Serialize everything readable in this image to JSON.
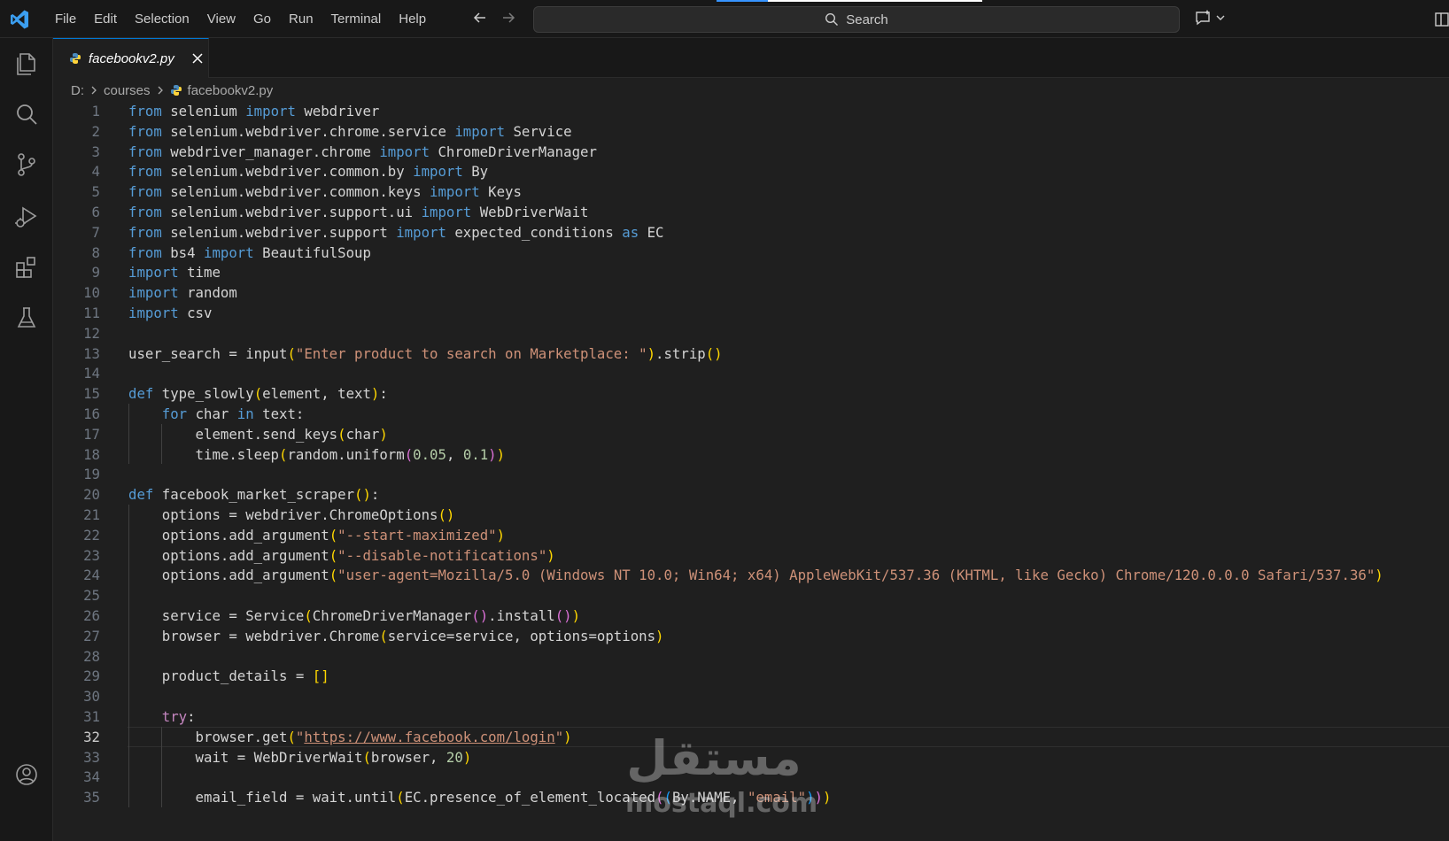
{
  "menu": [
    "File",
    "Edit",
    "Selection",
    "View",
    "Go",
    "Run",
    "Terminal",
    "Help"
  ],
  "search": {
    "label": "Search"
  },
  "tab": {
    "name": "facebookv2.py"
  },
  "breadcrumb": {
    "drive": "D:",
    "folder": "courses",
    "file": "facebookv2.py"
  },
  "editor": {
    "current_line": 32
  },
  "watermark": {
    "text": "mostaql.com",
    "logo_text": "مستقل"
  },
  "colors": {
    "accent": "#0078d4",
    "keyword": "#569cd6",
    "control": "#c586c0",
    "function": "#dcdcaa",
    "string": "#ce9178",
    "number": "#b5cea8"
  },
  "icons": [
    "explorer-icon",
    "search-icon",
    "source-control-icon",
    "run-debug-icon",
    "extensions-icon",
    "testing-icon",
    "account-icon",
    "python-file-icon",
    "close-icon",
    "copilot-icon",
    "layout-icon"
  ],
  "code_lines": [
    [
      [
        "kw",
        "from"
      ],
      [
        "plain",
        " selenium "
      ],
      [
        "kw",
        "import"
      ],
      [
        "plain",
        " webdriver"
      ]
    ],
    [
      [
        "kw",
        "from"
      ],
      [
        "plain",
        " selenium.webdriver.chrome.service "
      ],
      [
        "kw",
        "import"
      ],
      [
        "plain",
        " Service"
      ]
    ],
    [
      [
        "kw",
        "from"
      ],
      [
        "plain",
        " webdriver_manager.chrome "
      ],
      [
        "kw",
        "import"
      ],
      [
        "plain",
        " ChromeDriverManager"
      ]
    ],
    [
      [
        "kw",
        "from"
      ],
      [
        "plain",
        " selenium.webdriver.common.by "
      ],
      [
        "kw",
        "import"
      ],
      [
        "plain",
        " By"
      ]
    ],
    [
      [
        "kw",
        "from"
      ],
      [
        "plain",
        " selenium.webdriver.common.keys "
      ],
      [
        "kw",
        "import"
      ],
      [
        "plain",
        " Keys"
      ]
    ],
    [
      [
        "kw",
        "from"
      ],
      [
        "plain",
        " selenium.webdriver.support.ui "
      ],
      [
        "kw",
        "import"
      ],
      [
        "plain",
        " WebDriverWait"
      ]
    ],
    [
      [
        "kw",
        "from"
      ],
      [
        "plain",
        " selenium.webdriver.support "
      ],
      [
        "kw",
        "import"
      ],
      [
        "plain",
        " expected_conditions "
      ],
      [
        "kw",
        "as"
      ],
      [
        "plain",
        " EC"
      ]
    ],
    [
      [
        "kw",
        "from"
      ],
      [
        "plain",
        " bs4 "
      ],
      [
        "kw",
        "import"
      ],
      [
        "plain",
        " BeautifulSoup"
      ]
    ],
    [
      [
        "kw",
        "import"
      ],
      [
        "plain",
        " time"
      ]
    ],
    [
      [
        "kw",
        "import"
      ],
      [
        "plain",
        " random"
      ]
    ],
    [
      [
        "kw",
        "import"
      ],
      [
        "plain",
        " csv"
      ]
    ],
    [],
    [
      [
        "plain",
        "user_search = input"
      ],
      [
        "b1",
        "("
      ],
      [
        "str",
        "\"Enter product to search on Marketplace: \""
      ],
      [
        "b1",
        ")"
      ],
      [
        "plain",
        ".strip"
      ],
      [
        "b1",
        "()"
      ]
    ],
    [],
    [
      [
        "kw",
        "def"
      ],
      [
        "plain",
        " type_slowly"
      ],
      [
        "b1",
        "("
      ],
      [
        "plain",
        "element, text"
      ],
      [
        "b1",
        ")"
      ],
      [
        "plain",
        ":"
      ]
    ],
    [
      [
        "plain",
        "    "
      ],
      [
        "kw",
        "for"
      ],
      [
        "plain",
        " char "
      ],
      [
        "kw",
        "in"
      ],
      [
        "plain",
        " text:"
      ]
    ],
    [
      [
        "plain",
        "        element.send_keys"
      ],
      [
        "b1",
        "("
      ],
      [
        "plain",
        "char"
      ],
      [
        "b1",
        ")"
      ]
    ],
    [
      [
        "plain",
        "        time.sleep"
      ],
      [
        "b1",
        "("
      ],
      [
        "plain",
        "random.uniform"
      ],
      [
        "b2",
        "("
      ],
      [
        "num",
        "0.05"
      ],
      [
        "plain",
        ", "
      ],
      [
        "num",
        "0.1"
      ],
      [
        "b2",
        ")"
      ],
      [
        "b1",
        ")"
      ]
    ],
    [],
    [
      [
        "kw",
        "def"
      ],
      [
        "plain",
        " facebook_market_scraper"
      ],
      [
        "b1",
        "()"
      ],
      [
        "plain",
        ":"
      ]
    ],
    [
      [
        "plain",
        "    options = webdriver.ChromeOptions"
      ],
      [
        "b1",
        "()"
      ]
    ],
    [
      [
        "plain",
        "    options.add_argument"
      ],
      [
        "b1",
        "("
      ],
      [
        "str",
        "\"--start-maximized\""
      ],
      [
        "b1",
        ")"
      ]
    ],
    [
      [
        "plain",
        "    options.add_argument"
      ],
      [
        "b1",
        "("
      ],
      [
        "str",
        "\"--disable-notifications\""
      ],
      [
        "b1",
        ")"
      ]
    ],
    [
      [
        "plain",
        "    options.add_argument"
      ],
      [
        "b1",
        "("
      ],
      [
        "str",
        "\"user-agent=Mozilla/5.0 (Windows NT 10.0; Win64; x64) AppleWebKit/537.36 (KHTML, like Gecko) Chrome/120.0.0.0 Safari/537.36\""
      ],
      [
        "b1",
        ")"
      ]
    ],
    [],
    [
      [
        "plain",
        "    service = Service"
      ],
      [
        "b1",
        "("
      ],
      [
        "plain",
        "ChromeDriverManager"
      ],
      [
        "b2",
        "()"
      ],
      [
        "plain",
        ".install"
      ],
      [
        "b2",
        "()"
      ],
      [
        "b1",
        ")"
      ]
    ],
    [
      [
        "plain",
        "    browser = webdriver.Chrome"
      ],
      [
        "b1",
        "("
      ],
      [
        "plain",
        "service=service, options=options"
      ],
      [
        "b1",
        ")"
      ]
    ],
    [],
    [
      [
        "plain",
        "    product_details = "
      ],
      [
        "b1",
        "[]"
      ]
    ],
    [],
    [
      [
        "plain",
        "    "
      ],
      [
        "kw2",
        "try"
      ],
      [
        "plain",
        ":"
      ]
    ],
    [
      [
        "plain",
        "        browser.get"
      ],
      [
        "b1",
        "("
      ],
      [
        "str",
        "\""
      ],
      [
        "url",
        "https://www.facebook.com/login"
      ],
      [
        "str",
        "\""
      ],
      [
        "b1",
        ")"
      ]
    ],
    [
      [
        "plain",
        "        wait = WebDriverWait"
      ],
      [
        "b1",
        "("
      ],
      [
        "plain",
        "browser, "
      ],
      [
        "num",
        "20"
      ],
      [
        "b1",
        ")"
      ]
    ],
    [],
    [
      [
        "plain",
        "        email_field = wait.until"
      ],
      [
        "b1",
        "("
      ],
      [
        "plain",
        "EC.presence_of_element_located"
      ],
      [
        "b2",
        "("
      ],
      [
        "b3",
        "("
      ],
      [
        "plain",
        "By.NAME, "
      ],
      [
        "str",
        "\"email\""
      ],
      [
        "b3",
        ")"
      ],
      [
        "b2",
        ")"
      ],
      [
        "b1",
        ")"
      ]
    ]
  ]
}
